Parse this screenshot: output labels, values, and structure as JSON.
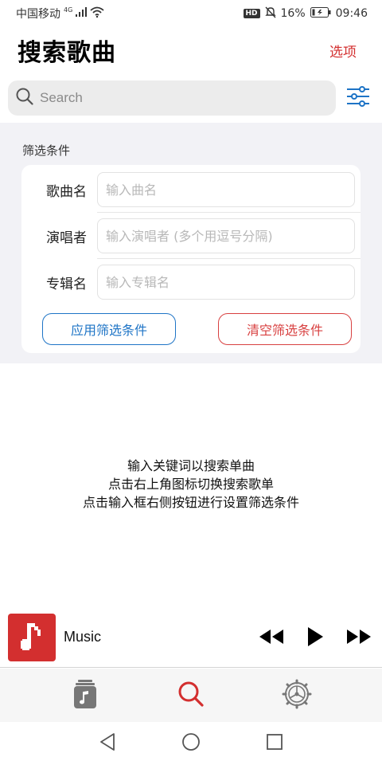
{
  "status_bar": {
    "carrier": "中国移动",
    "network": "4G",
    "hd": "HD",
    "battery": "16%",
    "time": "09:46"
  },
  "header": {
    "title": "搜索歌曲",
    "options_label": "选项"
  },
  "search": {
    "placeholder": "Search",
    "value": ""
  },
  "filter": {
    "heading": "筛选条件",
    "fields": [
      {
        "label": "歌曲名",
        "placeholder": "输入曲名"
      },
      {
        "label": "演唱者",
        "placeholder": "输入演唱者 (多个用逗号分隔)"
      },
      {
        "label": "专辑名",
        "placeholder": "输入专辑名"
      }
    ],
    "apply_label": "应用筛选条件",
    "clear_label": "清空筛选条件"
  },
  "hint": {
    "line1": "输入关键词以搜索单曲",
    "line2": "点击右上角图标切换搜索歌单",
    "line3": "点击输入框右侧按钮进行设置筛选条件"
  },
  "player": {
    "track_title": "Music"
  },
  "colors": {
    "accent_red": "#d32f2f",
    "accent_blue": "#1e74c6"
  },
  "icons": {
    "search": "search-icon",
    "filter": "sliders-icon",
    "album": "music-note-icon",
    "prev": "rewind-icon",
    "play": "play-icon",
    "next": "fast-forward-icon",
    "library_tab": "library-icon",
    "search_tab": "search-icon",
    "settings_tab": "settings-icon"
  }
}
